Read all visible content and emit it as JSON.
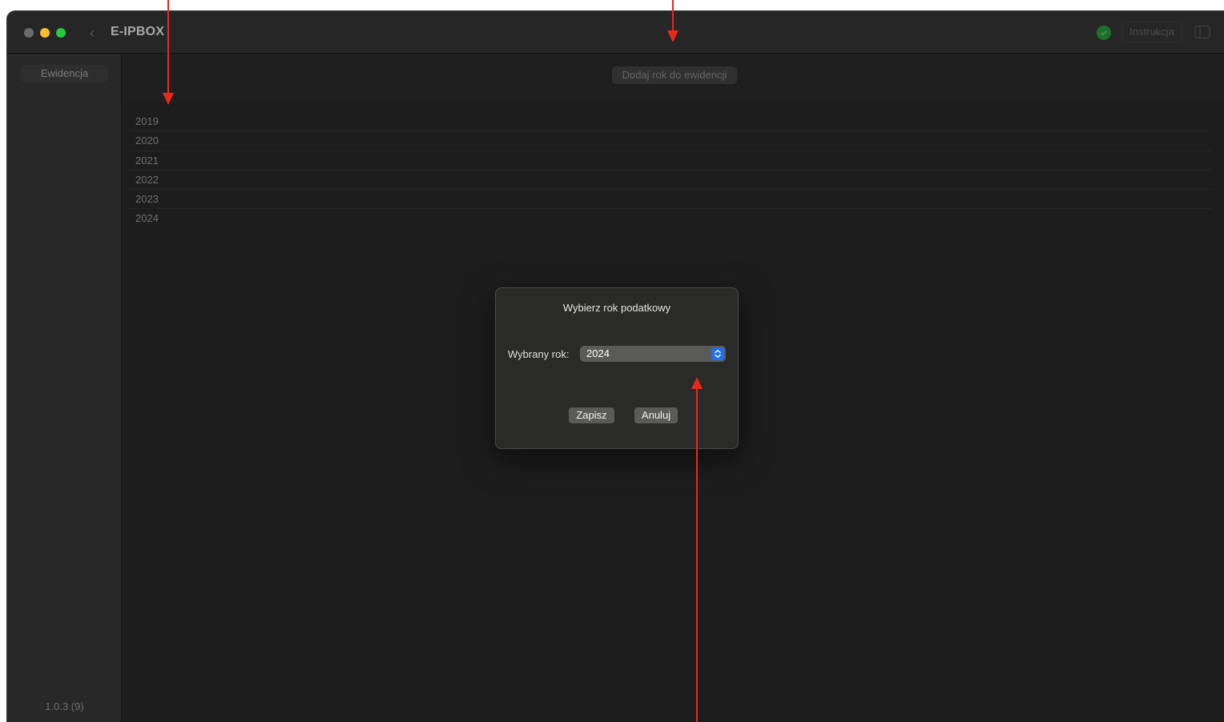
{
  "window": {
    "app_title": "E-IPBOX",
    "instruction_label": "Instrukcja"
  },
  "sidebar": {
    "items": [
      {
        "label": "Ewidencja"
      }
    ],
    "version": "1.0.3 (9)"
  },
  "toolbar": {
    "add_year_label": "Dodaj rok do ewidencji"
  },
  "years": [
    "2019",
    "2020",
    "2021",
    "2022",
    "2023",
    "2024"
  ],
  "dialog": {
    "title": "Wybierz rok podatkowy",
    "field_label": "Wybrany rok:",
    "selected_year": "2024",
    "save_label": "Zapisz",
    "cancel_label": "Anuluj"
  },
  "colors": {
    "accent": "#1f6ff0",
    "status_ok": "#1f6e2c",
    "annotation_arrow": "#e8291c"
  },
  "icons": {
    "back": "chevron-left-icon",
    "status": "checkmark-circle-icon",
    "sidebar_toggle": "sidebar-toggle-icon",
    "select": "up-down-chevron-icon"
  }
}
